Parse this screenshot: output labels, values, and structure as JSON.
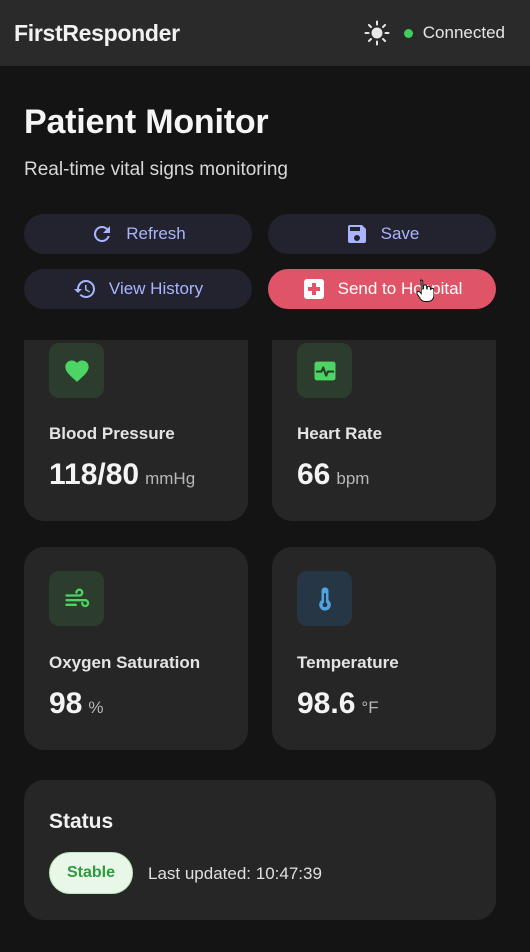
{
  "header": {
    "app_title": "FirstResponder",
    "theme_icon": "sun-icon",
    "connection_text": "Connected",
    "connection_color": "#3ecf5a"
  },
  "main": {
    "title": "Patient Monitor",
    "subtitle": "Real-time vital signs monitoring"
  },
  "actions": {
    "refresh": {
      "label": "Refresh",
      "icon": "refresh-icon"
    },
    "save": {
      "label": "Save",
      "icon": "save-icon"
    },
    "history": {
      "label": "View History",
      "icon": "history-icon"
    },
    "send": {
      "label": "Send to Hospital",
      "icon": "plus-square-icon",
      "color": "#e05468"
    }
  },
  "vitals": [
    {
      "label": "Blood Pressure",
      "value": "118/80",
      "unit": "mmHg",
      "icon": "heart-icon",
      "accent": "#4cd464"
    },
    {
      "label": "Heart Rate",
      "value": "66",
      "unit": "bpm",
      "icon": "pulse-monitor-icon",
      "accent": "#4cd464"
    },
    {
      "label": "Oxygen Saturation",
      "value": "98",
      "unit": "%",
      "icon": "wind-icon",
      "accent": "#4cd464"
    },
    {
      "label": "Temperature",
      "value": "98.6",
      "unit": "°F",
      "icon": "thermometer-icon",
      "accent": "#4fa3e0"
    }
  ],
  "status": {
    "title": "Status",
    "badge": "Stable",
    "badge_color": "#2e9b3c",
    "updated_label": "Last updated: 10:47:39"
  }
}
